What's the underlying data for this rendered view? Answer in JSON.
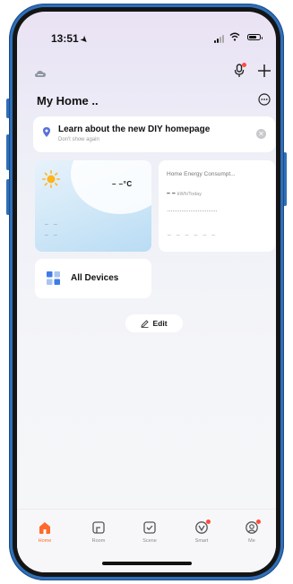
{
  "status_bar": {
    "time": "13:51"
  },
  "header": {
    "title": "My Home .."
  },
  "banner": {
    "title": "Learn about the new DIY homepage",
    "subtitle": "Don't show again"
  },
  "weather_card": {
    "temperature": "– –°C",
    "placeholder_1": "– –",
    "placeholder_2": "– –"
  },
  "energy_card": {
    "title": "Home Energy Consumpt...",
    "value": "– –",
    "unit": "kWh/Today",
    "placeholder": "– – – – – –"
  },
  "devices_card": {
    "label": "All Devices"
  },
  "edit_button": {
    "label": "Edit"
  },
  "tabbar": {
    "tabs": [
      {
        "label": "Home",
        "icon": "home-icon",
        "active": true
      },
      {
        "label": "Room",
        "icon": "room-icon"
      },
      {
        "label": "Scene",
        "icon": "scene-icon"
      },
      {
        "label": "Smart",
        "icon": "smart-icon"
      },
      {
        "label": "Me",
        "icon": "me-icon"
      }
    ]
  },
  "colors": {
    "accent": "#ff6a2a",
    "notification_dot": "#ff4d3d",
    "phone_frame": "#2f6fb9"
  }
}
